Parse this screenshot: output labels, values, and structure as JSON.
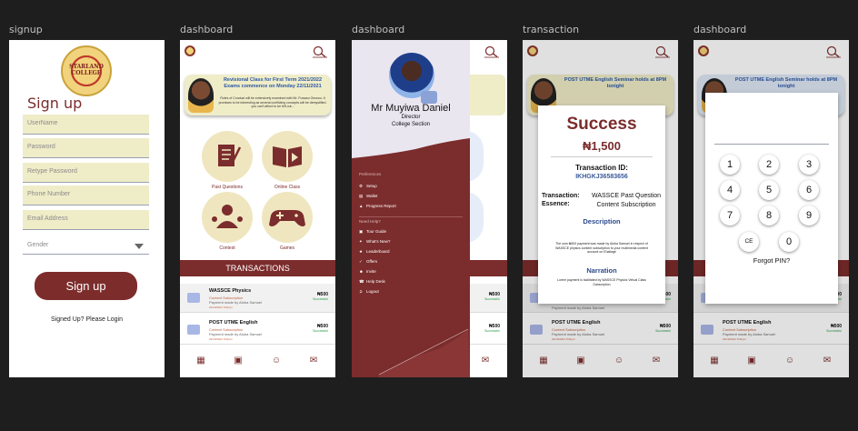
{
  "frames": {
    "signup": "signup",
    "dashboard1": "dashboard",
    "dashboard2": "dashboard",
    "transaction": "transaction",
    "dashboard3": "dashboard"
  },
  "signup": {
    "logo_text": "STARLAND COLLEGE",
    "title": "Sign up",
    "fields": [
      "UserName",
      "Password",
      "Retype Password",
      "Phone Number",
      "Email Address"
    ],
    "gender_placeholder": "Gender",
    "button": "Sign up",
    "login_link": "Signed Up? Please Login"
  },
  "dashboard": {
    "banner1": {
      "title": "Revisional Class for First Term 2021/2022 Exams commence on Monday 22/11/2021",
      "text": "Rules of Conduct will be extensively examined with Mr. Fuwaso Omowu. It promises to be interesting as several conflicting concepts will be demystified. you can't afford to be left out..."
    },
    "banner2": {
      "title": "POST UTME English Seminar holds at 8PM tonight",
      "text": "Rules of Conduct will be extensively examined with Mr. Fuwaso Omowu. It promises to be interesting as several conflicting concepts will be demystified. you can't afford to be left out..."
    },
    "grid": [
      "Past Questions",
      "Online Class",
      "Contest",
      "Games"
    ],
    "transactions_header": "TRANSACTIONS",
    "tx": [
      {
        "title": "WASSCE Physics",
        "sub": "Content Subscription",
        "payer": "Payment made by Aloba Samuel",
        "date": "24/10/2021 5:01pm",
        "amount": "₦500",
        "status": "Successful"
      },
      {
        "title": "POST UTME English",
        "sub": "Content Subscription",
        "payer": "Payment made by Aloba Samuel",
        "date": "24/10/2021 5:01pm",
        "amount": "₦500",
        "status": "Successful"
      }
    ]
  },
  "drawer": {
    "name": "Mr Muyiwa Daniel",
    "role": "Director",
    "dept": "College Section",
    "section1": "Preferences",
    "items1": [
      "Setup",
      "Wallet",
      "Progress Report"
    ],
    "section2": "Need Help?",
    "items2": [
      "Tour Guide",
      "What's New?",
      "Leaderboard",
      "Offers",
      "Invite",
      "Help Desk",
      "Logout"
    ]
  },
  "success": {
    "title": "Success",
    "amount": "₦1,500",
    "tid_label": "Transaction ID:",
    "tid": "IKHGKJ36583656",
    "essence_label": "Transaction: Essence:",
    "essence": "WASSCE Past Question Content Subscription",
    "desc_h": "Description",
    "desc": "The sum ₦500 payment was made by Aloba Samuel in respect of WASSCE physics content subscription to your multimedia content account on Ehallage",
    "narr_h": "Narration",
    "narr": "Lorem payment is facilitated by WASSCE Physics Virtual Class Subscription"
  },
  "pin": {
    "keys": [
      "1",
      "2",
      "3",
      "4",
      "5",
      "6",
      "7",
      "8",
      "9",
      "CE",
      "0"
    ],
    "forgot": "Forgot PIN?"
  },
  "colors": {
    "brand": "#7b2c2c",
    "field_bg": "#efecc8",
    "accent_blue": "#2b58a7"
  }
}
